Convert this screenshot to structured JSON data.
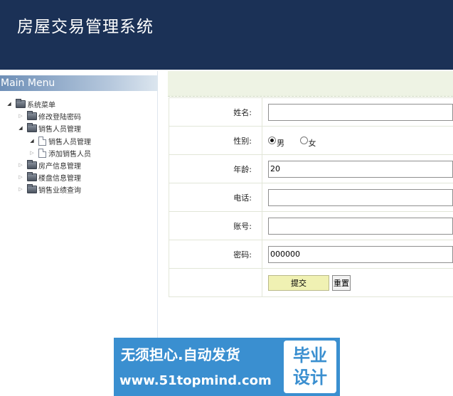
{
  "header": {
    "title": "房屋交易管理系统"
  },
  "sidebar": {
    "title": "Main Menu",
    "root": {
      "label": "系统菜单"
    },
    "items": [
      {
        "label": "修改登陆密码"
      },
      {
        "label": "销售人员管理"
      },
      {
        "label": "销售人员管理"
      },
      {
        "label": "添加销售人员"
      },
      {
        "label": "房产信息管理"
      },
      {
        "label": "楼盘信息管理"
      },
      {
        "label": "销售业绩查询"
      }
    ]
  },
  "form": {
    "name_label": "姓名:",
    "name_value": "",
    "gender_label": "性别:",
    "gender_male": "男",
    "gender_female": "女",
    "age_label": "年龄:",
    "age_value": "20",
    "phone_label": "电话:",
    "phone_value": "",
    "account_label": "账号:",
    "account_value": "",
    "password_label": "密码:",
    "password_value": "000000",
    "submit_label": "提交",
    "reset_label": "重置"
  },
  "watermark": {
    "line1": "无须担心.自动发货",
    "line2": "www.51topmind.com",
    "logo": "毕业\n设计"
  }
}
